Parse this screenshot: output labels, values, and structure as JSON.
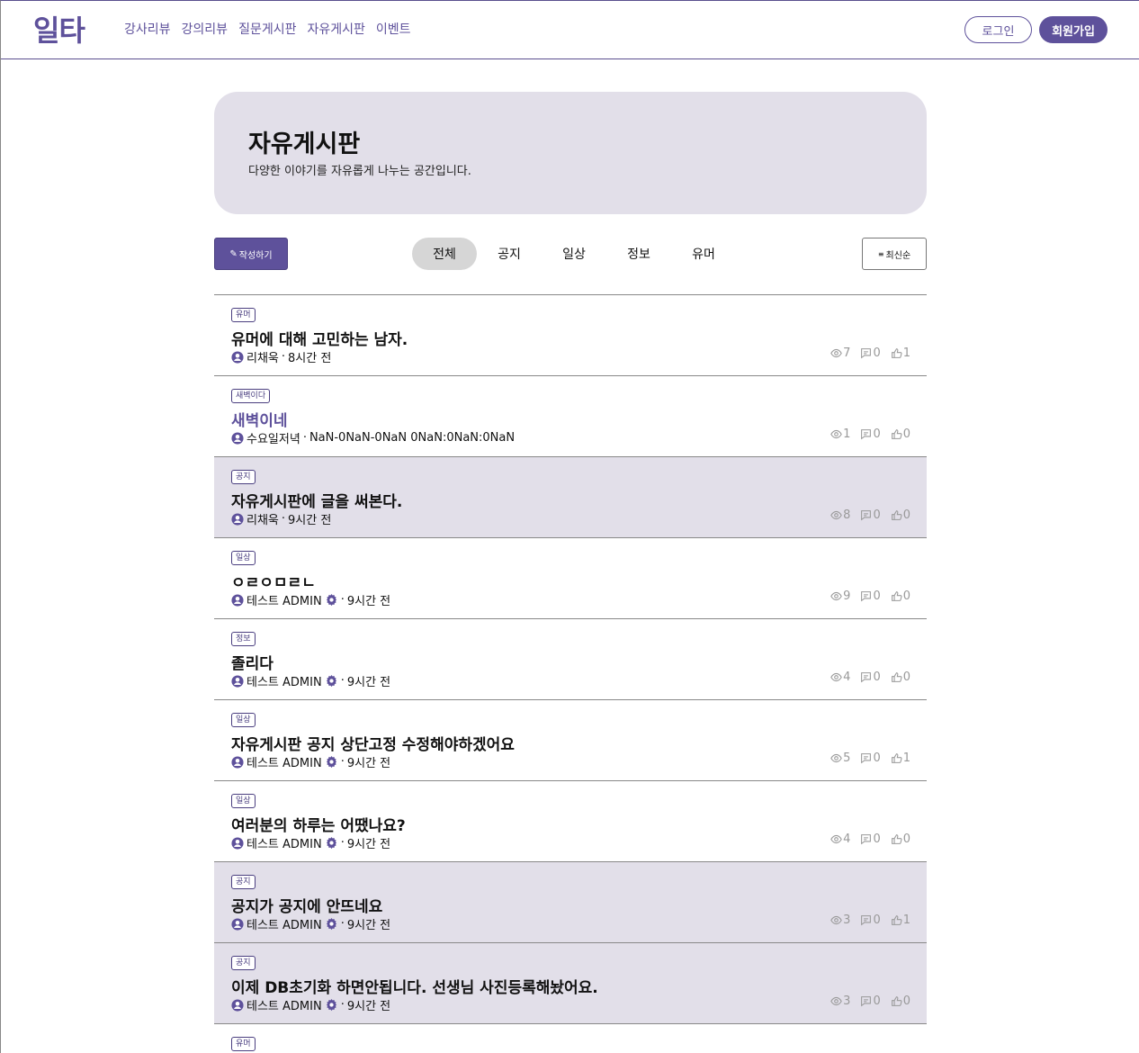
{
  "header": {
    "logo": "일타",
    "nav": [
      "강사리뷰",
      "강의리뷰",
      "질문게시판",
      "자유게시판",
      "이벤트"
    ],
    "login": "로그인",
    "signup": "회원가입"
  },
  "hero": {
    "title": "자유게시판",
    "subtitle": "다양한 이야기를 자유롭게 나누는 공간입니다."
  },
  "toolbar": {
    "write_label": "작성하기",
    "sort_label": "최신순",
    "tabs": [
      "전체",
      "공지",
      "일상",
      "정보",
      "유머"
    ],
    "active_tab": "전체"
  },
  "posts": [
    {
      "category": "유머",
      "title": "유머에 대해 고민하는 남자.",
      "author": "리채욱",
      "time": "8시간 전",
      "admin": false,
      "notice": false,
      "views": "7",
      "comments": "0",
      "likes": "1"
    },
    {
      "category": "새벽이다",
      "title": "새벽이네",
      "author": "수요일저녁",
      "time": "NaN-0NaN-0NaN 0NaN:0NaN:0NaN",
      "admin": false,
      "notice": false,
      "highlight": true,
      "views": "1",
      "comments": "0",
      "likes": "0"
    },
    {
      "category": "공지",
      "title": "자유게시판에 글을 써본다.",
      "author": "리채욱",
      "time": "9시간 전",
      "admin": false,
      "notice": true,
      "views": "8",
      "comments": "0",
      "likes": "0"
    },
    {
      "category": "일상",
      "title": "ㅇㄹㅇㅁㄹㄴ",
      "author": "테스트 ADMIN",
      "time": "9시간 전",
      "admin": true,
      "notice": false,
      "views": "9",
      "comments": "0",
      "likes": "0"
    },
    {
      "category": "정보",
      "title": "졸리다",
      "author": "테스트 ADMIN",
      "time": "9시간 전",
      "admin": true,
      "notice": false,
      "views": "4",
      "comments": "0",
      "likes": "0"
    },
    {
      "category": "일상",
      "title": "자유게시판 공지 상단고정 수정해야하겠어요",
      "author": "테스트 ADMIN",
      "time": "9시간 전",
      "admin": true,
      "notice": false,
      "views": "5",
      "comments": "0",
      "likes": "1"
    },
    {
      "category": "일상",
      "title": "여러분의 하루는 어땠나요?",
      "author": "테스트 ADMIN",
      "time": "9시간 전",
      "admin": true,
      "notice": false,
      "views": "4",
      "comments": "0",
      "likes": "0"
    },
    {
      "category": "공지",
      "title": "공지가 공지에 안뜨네요",
      "author": "테스트 ADMIN",
      "time": "9시간 전",
      "admin": true,
      "notice": true,
      "views": "3",
      "comments": "0",
      "likes": "1"
    },
    {
      "category": "공지",
      "title": "이제 DB초기화 하면안됩니다. 선생님 사진등록해놨어요.",
      "author": "테스트 ADMIN",
      "time": "9시간 전",
      "admin": true,
      "notice": true,
      "views": "3",
      "comments": "0",
      "likes": "0"
    },
    {
      "category": "유머",
      "title": "",
      "author": "",
      "time": "",
      "admin": false,
      "notice": false,
      "views": "",
      "comments": "",
      "likes": ""
    }
  ],
  "colors": {
    "accent": "#5e519b",
    "notice_bg": "#e2dfe9",
    "hero_bg": "#e2dfe9"
  }
}
